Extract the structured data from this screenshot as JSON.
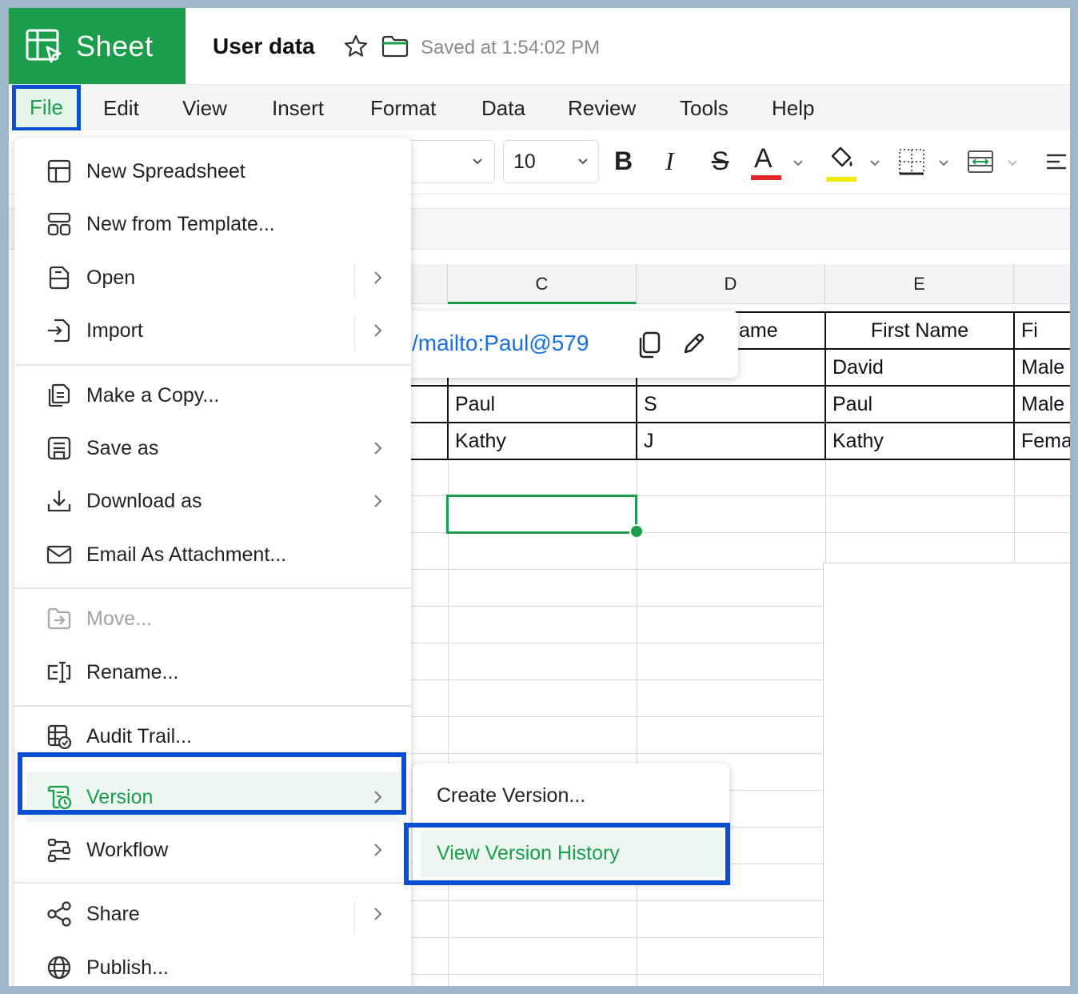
{
  "app": {
    "name": "Sheet",
    "doc_title": "User data",
    "saved_text": "Saved at 1:54:02 PM",
    "accent": "#1a9e4b",
    "highlight": "#0a4fd1"
  },
  "menubar": {
    "file": "File",
    "edit": "Edit",
    "view": "View",
    "insert": "Insert",
    "format": "Format",
    "data": "Data",
    "review": "Review",
    "tools": "Tools",
    "help": "Help"
  },
  "toolbar": {
    "font_size": "10",
    "bold": "B",
    "italic": "I",
    "strike": "S",
    "font_color": "A"
  },
  "grid": {
    "columns": [
      "C",
      "D",
      "E"
    ],
    "header_row": {
      "d": "ame",
      "e": "First Name",
      "f": "Fi"
    },
    "rows": [
      {
        "c": "",
        "d": "",
        "e": "David",
        "f": "Male"
      },
      {
        "c": "Paul",
        "d": "S",
        "e": "Paul",
        "f": "Male"
      },
      {
        "c": "Kathy",
        "d": "J",
        "e": "Kathy",
        "f": "Fema"
      }
    ]
  },
  "link_popup": {
    "text": "/mailto:Paul@579"
  },
  "file_menu": {
    "new_spreadsheet": "New Spreadsheet",
    "new_from_template": "New from Template...",
    "open": "Open",
    "import": "Import",
    "make_copy": "Make a Copy...",
    "save_as": "Save as",
    "download_as": "Download as",
    "email_attachment": "Email As Attachment...",
    "move": "Move...",
    "rename": "Rename...",
    "audit_trail": "Audit Trail...",
    "version": "Version",
    "workflow": "Workflow",
    "share": "Share",
    "publish": "Publish..."
  },
  "version_submenu": {
    "create": "Create Version...",
    "view_history": "View Version History"
  }
}
